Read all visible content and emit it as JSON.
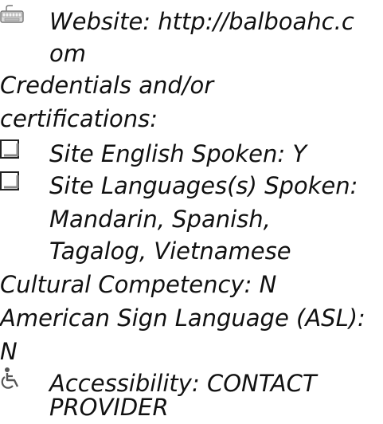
{
  "website": {
    "icon": "keyboard-icon",
    "line1": "Website: http://balboahc.c",
    "line2": "om"
  },
  "credentials": {
    "line1": "Credentials and/or",
    "line2": "certifications:"
  },
  "english": {
    "icon": "checkbox-icon",
    "text": "Site English Spoken: Y"
  },
  "languages": {
    "icon": "checkbox-icon",
    "line1": "Site Languages(s) Spoken:",
    "line2": "Mandarin, Spanish,",
    "line3": "Tagalog, Vietnamese"
  },
  "cultural": {
    "text": "Cultural Competency: N"
  },
  "asl": {
    "line1": "American Sign Language (ASL):",
    "line2": "N"
  },
  "accessibility": {
    "icon": "wheelchair-icon",
    "line1": "Accessibility: CONTACT",
    "line2": "PROVIDER"
  }
}
